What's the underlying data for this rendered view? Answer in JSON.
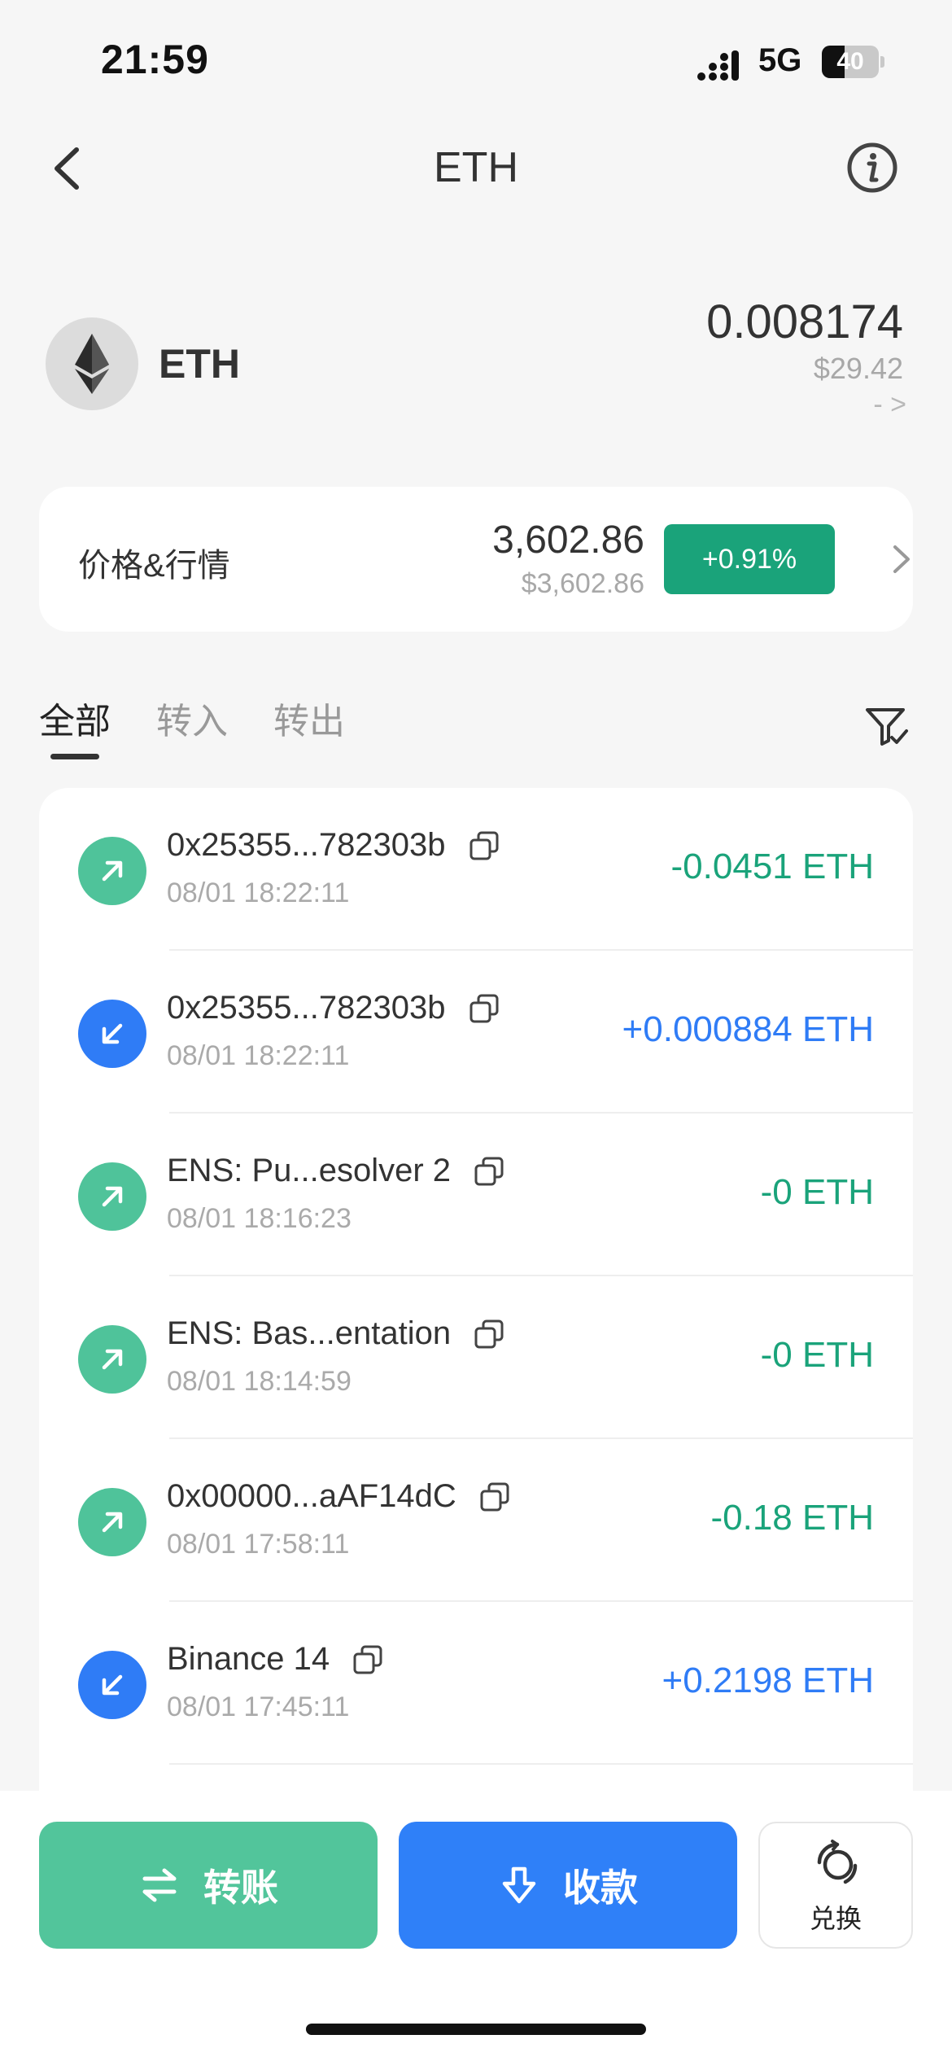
{
  "status_bar": {
    "time": "21:59",
    "network": "5G",
    "battery": "40",
    "battery_level": 0.4
  },
  "nav": {
    "title": "ETH",
    "back_icon": "chevron-left-icon",
    "info_icon": "info-icon"
  },
  "asset": {
    "symbol": "ETH",
    "balance": "0.008174",
    "balance_usd": "$29.42",
    "link": "- >"
  },
  "price_card": {
    "label": "价格&行情",
    "price": "3,602.86",
    "price_usd": "$3,602.86",
    "change": "+0.91%",
    "change_color": "#1aa37a"
  },
  "tabs": [
    {
      "label": "全部",
      "active": true
    },
    {
      "label": "转入",
      "active": false
    },
    {
      "label": "转出",
      "active": false
    }
  ],
  "transactions": [
    {
      "direction": "out",
      "address": "0x25355...782303b",
      "time": "08/01 18:22:11",
      "amount": "-0.0451 ETH"
    },
    {
      "direction": "in",
      "address": "0x25355...782303b",
      "time": "08/01 18:22:11",
      "amount": "+0.000884 ETH"
    },
    {
      "direction": "out",
      "address": "ENS: Pu...esolver 2",
      "time": "08/01 18:16:23",
      "amount": "-0 ETH"
    },
    {
      "direction": "out",
      "address": "ENS: Bas...entation",
      "time": "08/01 18:14:59",
      "amount": "-0 ETH"
    },
    {
      "direction": "out",
      "address": "0x00000...aAF14dC",
      "time": "08/01 17:58:11",
      "amount": "-0.18 ETH"
    },
    {
      "direction": "in",
      "address": "Binance 14",
      "time": "08/01 17:45:11",
      "amount": "+0.2198 ETH"
    }
  ],
  "actions": {
    "transfer": "转账",
    "receive": "收款",
    "swap": "兑换"
  },
  "colors": {
    "outgoing": "#1aa37a",
    "incoming": "#2f7cf6",
    "transfer_button": "#52c59b",
    "receive_button": "#2f80f8"
  }
}
